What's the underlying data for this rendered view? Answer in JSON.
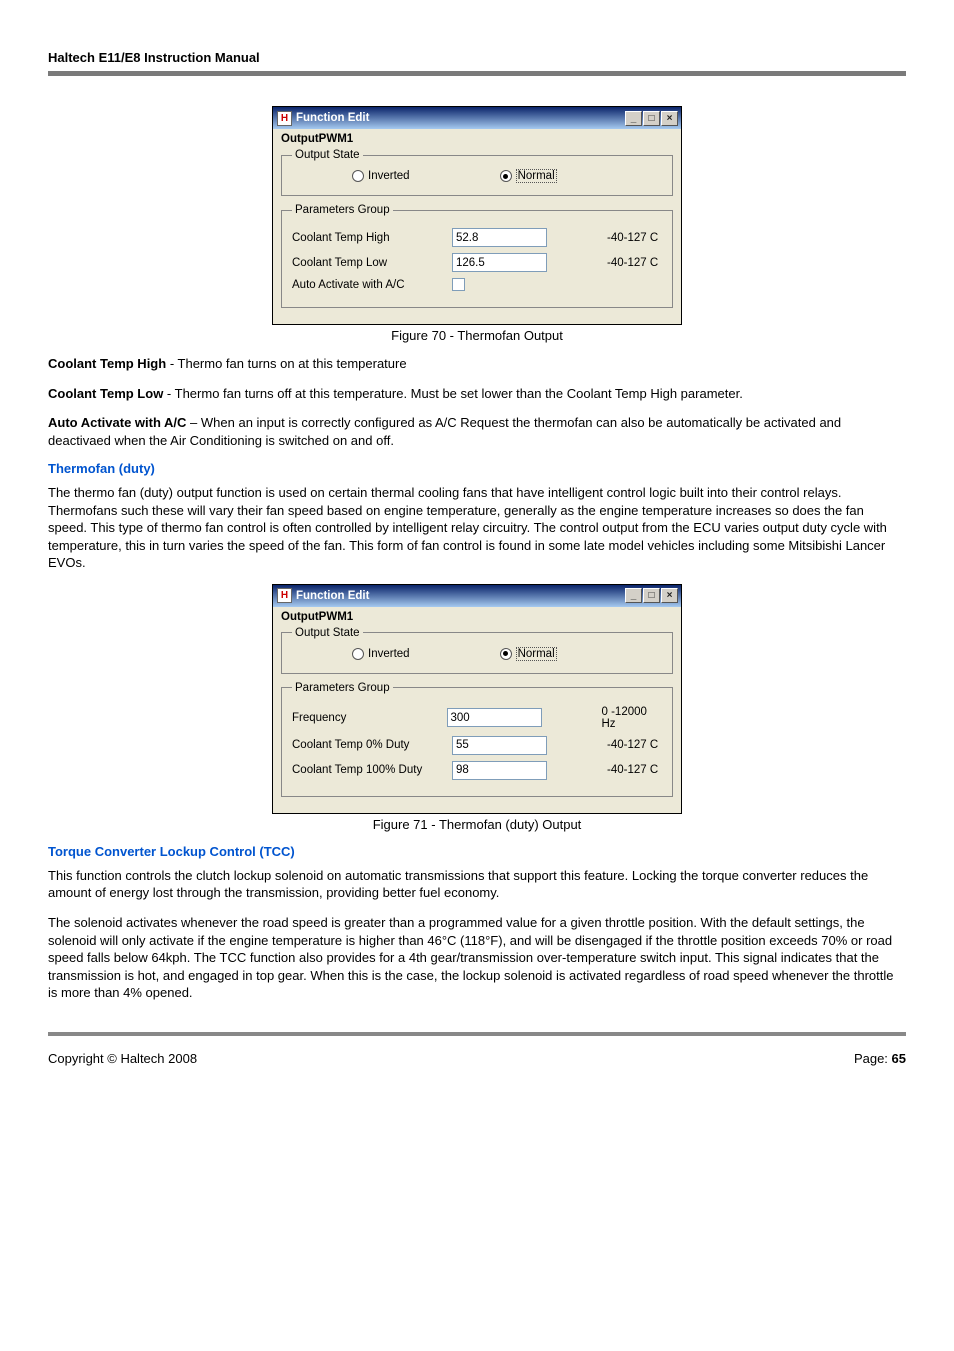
{
  "header": "Haltech E11/E8 Instruction Manual",
  "dialog1": {
    "titlebar_title": "Function Edit",
    "btn_min": "_",
    "btn_max": "□",
    "btn_close": "×",
    "name": "OutputPWM1",
    "output_state_legend": "Output State",
    "radio_inverted": "Inverted",
    "radio_normal": "Normal",
    "params_legend": "Parameters Group",
    "p1_label": "Coolant Temp High",
    "p1_value": "52.8",
    "p1_range": "-40-127 C",
    "p2_label": "Coolant Temp Low",
    "p2_value": "126.5",
    "p2_range": "-40-127 C",
    "p3_label": "Auto Activate with A/C"
  },
  "caption1": "Figure 70 - Thermofan Output",
  "text1_bold": "Coolant Temp High",
  "text1_rest": " - Thermo fan turns on at this temperature",
  "text2_bold": "Coolant Temp Low",
  "text2_rest": " - Thermo fan turns off at this temperature. Must be set lower than the Coolant Temp High parameter.",
  "text3_bold": "Auto Activate with A/C",
  "text3_rest": " – When an input is correctly configured as A/C Request the thermofan can also be automatically be activated and deactivaed when the Air Conditioning is switched on and off.",
  "section2_title": "Thermofan (duty)",
  "section2_body": "The thermo fan (duty) output function is used on certain thermal cooling fans that have intelligent control logic built into their control relays. Thermofans such these will vary their fan speed based on engine temperature, generally as the engine temperature increases so does the fan speed. This type of thermo fan control is often controlled by intelligent relay circuitry. The control output from the ECU varies output duty cycle with temperature, this in turn varies the speed of the fan. This form of fan control is found in some late model vehicles including some Mitsibishi Lancer EVOs.",
  "dialog2": {
    "titlebar_title": "Function Edit",
    "btn_min": "_",
    "btn_max": "□",
    "btn_close": "×",
    "name": "OutputPWM1",
    "output_state_legend": "Output State",
    "radio_inverted": "Inverted",
    "radio_normal": "Normal",
    "params_legend": "Parameters Group",
    "p1_label": "Frequency",
    "p1_value": "300",
    "p1_range": "0 -12000 Hz",
    "p2_label": "Coolant Temp 0% Duty",
    "p2_value": "55",
    "p2_range": "-40-127 C",
    "p3_label": "Coolant Temp 100% Duty",
    "p3_value": "98",
    "p3_range": "-40-127 C"
  },
  "caption2": "Figure 71 - Thermofan (duty) Output",
  "section3_title": "Torque Converter Lockup Control (TCC)",
  "section3_body1": "This function controls the clutch lockup solenoid on automatic transmissions that support this feature. Locking the torque converter reduces the amount of energy lost through the transmission, providing better fuel economy.",
  "section3_body2": "The solenoid activates whenever the road speed is greater than a programmed value for a given throttle position. With the default settings, the solenoid will only activate if the engine temperature is higher than 46°C (118°F), and will be disengaged if the throttle position exceeds 70% or road speed falls below 64kph. The TCC function also provides for a 4th gear/transmission over-temperature switch input. This signal indicates that the transmission is hot, and engaged in top gear. When this is the case, the lockup solenoid is activated regardless of road speed whenever the throttle is more than 4% opened.",
  "footer_left": "Copyright © Haltech 2008",
  "footer_right_label": "Page: ",
  "footer_right_num": "65"
}
